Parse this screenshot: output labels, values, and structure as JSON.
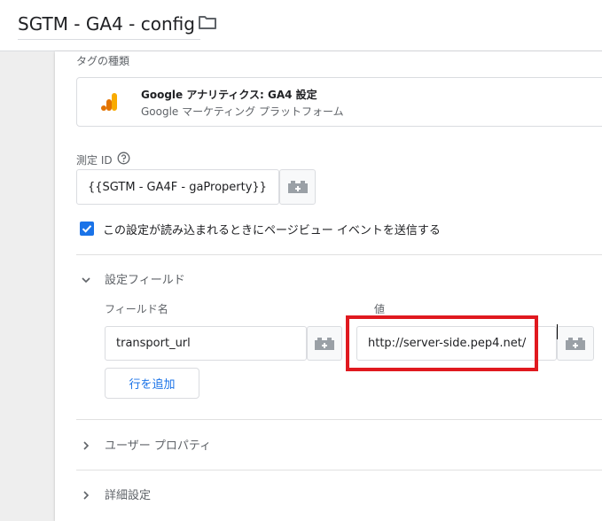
{
  "header": {
    "title": "SGTM - GA4 - config",
    "folder_icon": "folder-icon"
  },
  "tag_type": {
    "section_label": "タグの種類",
    "name": "Google アナリティクス: GA4 設定",
    "subtitle": "Google マーケティング プラットフォーム",
    "icon": "google-analytics-icon"
  },
  "measurement_id": {
    "label": "測定 ID",
    "value": "{{SGTM - GA4F - gaProperty}}",
    "help_icon": "help-icon",
    "variable_icon": "variable-picker-icon"
  },
  "send_pageview": {
    "checked": true,
    "label": "この設定が読み込まれるときにページビュー イベントを送信する"
  },
  "fields_to_set": {
    "section_label": "設定フィールド",
    "column_field_name": "フィールド名",
    "column_value": "値",
    "rows": [
      {
        "field_name": "transport_url",
        "value": "http://server-side.pep4.net/"
      }
    ],
    "add_row_label": "行を追加"
  },
  "user_properties": {
    "label": "ユーザー プロパティ"
  },
  "advanced_settings": {
    "label": "詳細設定"
  },
  "colors": {
    "accent": "#1a73e8",
    "highlight": "#e0191f",
    "ga_orange": "#f9ab00",
    "ga_dark_orange": "#e37400"
  }
}
